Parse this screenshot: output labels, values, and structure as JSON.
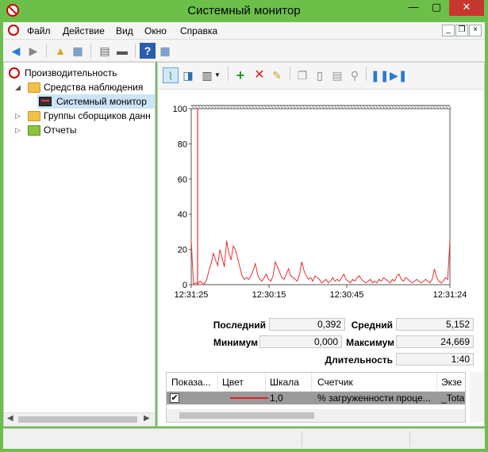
{
  "window": {
    "title": "Системный монитор",
    "controls": {
      "minimize": "—",
      "maximize": "▢",
      "close": "✕"
    }
  },
  "menubar": {
    "items": [
      "Файл",
      "Действие",
      "Вид",
      "Окно",
      "Справка"
    ],
    "mdi": {
      "minimize": "_",
      "restore": "❐",
      "close": "×"
    }
  },
  "tree": {
    "items": [
      {
        "label": "Производительность"
      },
      {
        "label": "Средства наблюдения"
      },
      {
        "label": "Системный монитор"
      },
      {
        "label": "Группы сборщиков данн"
      },
      {
        "label": "Отчеты"
      }
    ]
  },
  "graph": {
    "y_ticks": [
      "100",
      "80",
      "60",
      "40",
      "20",
      "0"
    ],
    "x_ticks": [
      "12:31:25",
      "12:30:15",
      "12:30:45",
      "12:31:24"
    ],
    "line_color": "#e83030"
  },
  "chart_data": {
    "type": "line",
    "ylim": [
      0,
      100
    ],
    "xlabel": "",
    "ylabel": "",
    "series": [
      {
        "values": [
          25,
          0.5,
          1,
          0.5,
          2,
          1,
          0.5,
          3,
          8,
          12,
          18,
          14,
          11,
          20,
          15,
          10,
          25,
          18,
          14,
          22,
          20,
          15,
          10,
          5,
          3,
          4,
          3,
          5,
          8,
          12,
          6,
          3,
          2,
          4,
          6,
          3,
          2,
          5,
          13,
          10,
          7,
          4,
          3,
          6,
          9,
          5,
          4,
          3,
          2,
          6,
          13,
          8,
          5,
          3,
          4,
          2,
          5,
          4,
          3,
          1,
          2,
          3,
          1,
          2,
          4,
          2,
          3,
          2,
          4,
          6,
          3,
          2,
          1,
          3,
          2,
          4,
          5,
          3,
          2,
          1,
          2,
          3,
          1,
          2,
          1,
          3,
          2,
          4,
          3,
          2,
          1,
          3,
          2,
          5,
          6,
          3,
          2,
          4,
          3,
          2,
          1,
          2,
          3,
          2,
          1,
          2,
          3,
          2,
          1,
          3,
          9,
          4,
          2,
          1,
          2,
          4,
          3,
          25
        ]
      }
    ]
  },
  "stats": {
    "last_label": "Последний",
    "last_value": "0,392",
    "avg_label": "Средний",
    "avg_value": "5,152",
    "min_label": "Минимум",
    "min_value": "0,000",
    "max_label": "Максимум",
    "max_value": "24,669",
    "dur_label": "Длительность",
    "dur_value": "1:40"
  },
  "counter_table": {
    "headers": [
      "Показа...",
      "Цвет",
      "Шкала",
      "Счетчик",
      "Экзе"
    ],
    "row": {
      "checked": "✔",
      "scale": "1,0",
      "counter": "% загруженности проце...",
      "instance": "_Tota"
    }
  }
}
